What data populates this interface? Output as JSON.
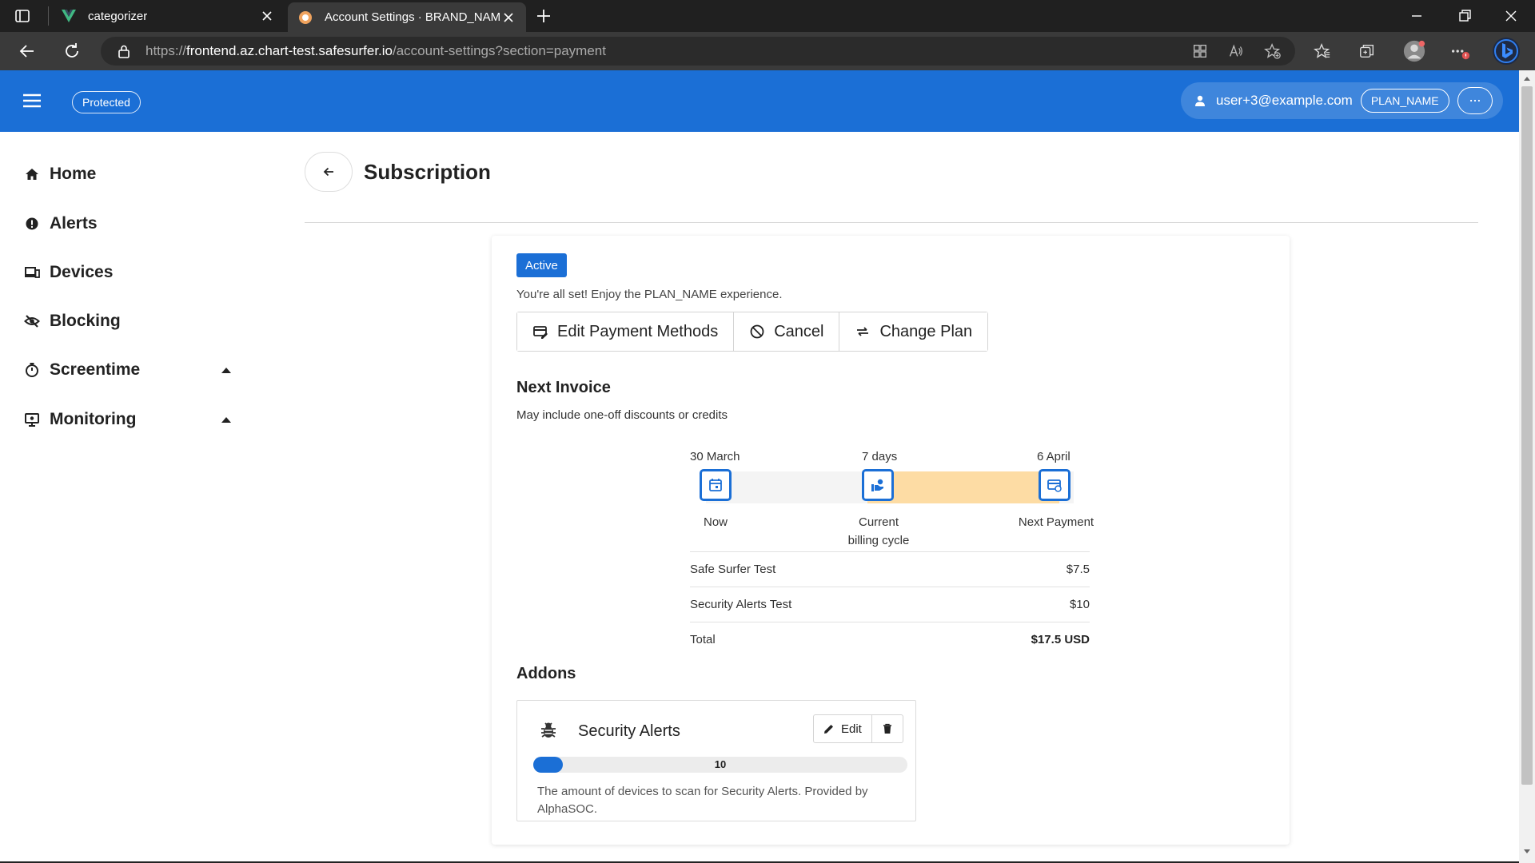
{
  "browser": {
    "tabs": [
      {
        "title": "categorizer",
        "icon": "vue-logo-icon"
      },
      {
        "title": "Account Settings · BRAND_NAME",
        "icon": "site-favicon-icon"
      }
    ],
    "url": {
      "scheme": "https://",
      "host": "frontend.az.chart-test.safesurfer.io",
      "path": "/account-settings?section=payment"
    }
  },
  "header": {
    "protected_label": "Protected",
    "user_email": "user+3@example.com",
    "plan_label": "PLAN_NAME",
    "more_label": "···",
    "brand_color": "#1b6fd6"
  },
  "sidebar": {
    "items": [
      {
        "label": "Home",
        "icon": "home-icon"
      },
      {
        "label": "Alerts",
        "icon": "alert-circle-icon"
      },
      {
        "label": "Devices",
        "icon": "devices-icon"
      },
      {
        "label": "Blocking",
        "icon": "eye-off-icon"
      },
      {
        "label": "Screentime",
        "icon": "timer-icon"
      },
      {
        "label": "Monitoring",
        "icon": "monitor-icon"
      }
    ]
  },
  "page": {
    "title": "Subscription"
  },
  "subscription": {
    "status": "Active",
    "status_text": "You're all set! Enjoy the PLAN_NAME experience.",
    "actions": {
      "edit_payment": "Edit Payment Methods",
      "cancel": "Cancel",
      "change_plan": "Change Plan"
    }
  },
  "next_invoice": {
    "heading": "Next Invoice",
    "subtitle": "May include one-off discounts or credits",
    "timeline": {
      "start_date": "30 March",
      "duration": "7 days",
      "end_date": "6 April",
      "start_label": "Now",
      "mid_label_1": "Current",
      "mid_label_2": "billing cycle",
      "end_label": "Next Payment"
    },
    "lines": [
      {
        "item": "Safe Surfer Test",
        "amount": "$7.5"
      },
      {
        "item": "Security Alerts Test",
        "amount": "$10"
      }
    ],
    "total": {
      "label": "Total",
      "amount": "$17.5 USD"
    }
  },
  "addons": {
    "heading": "Addons",
    "items": [
      {
        "name": "Security Alerts",
        "icon": "bug-icon",
        "edit_label": "Edit",
        "slider_value": "10",
        "slider_fraction": 0.08,
        "description": "The amount of devices to scan for Security Alerts. Provided by AlphaSOC."
      }
    ]
  }
}
